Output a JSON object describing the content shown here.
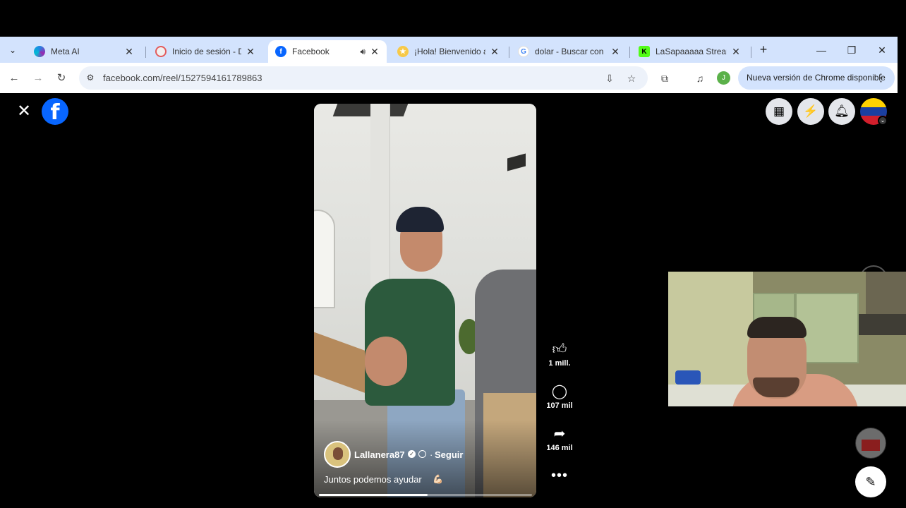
{
  "browser": {
    "tabs": [
      {
        "title": "Meta AI",
        "favicon": "meta-ai-icon",
        "active": false
      },
      {
        "title": "Inicio de sesión - Dro",
        "favicon": "login-icon",
        "active": false
      },
      {
        "title": "Facebook",
        "favicon": "facebook-icon",
        "active": true,
        "audio": true
      },
      {
        "title": "¡Hola! Bienvenido a T",
        "favicon": "star-icon",
        "active": false
      },
      {
        "title": "dolar - Buscar con Go",
        "favicon": "google-icon",
        "active": false
      },
      {
        "title": "LaSapaaaaa Stream -",
        "favicon": "kick-icon",
        "active": false
      }
    ],
    "url": "facebook.com/reel/1527594161789863",
    "profile_initial": "J",
    "update_label": "Nueva versión de Chrome disponible"
  },
  "reel": {
    "author": "Lallanera87",
    "separator": "·",
    "follow_label": "Seguir",
    "caption": "Juntos podemos ayudar",
    "caption_emoji": "💪🏻",
    "progress": 0.51
  },
  "actions": {
    "likes": "1 mill.",
    "comments": "107 mil",
    "shares": "146 mil"
  },
  "colors": {
    "facebook_blue": "#0866ff",
    "chrome_tab_strip": "#d3e3fd"
  }
}
